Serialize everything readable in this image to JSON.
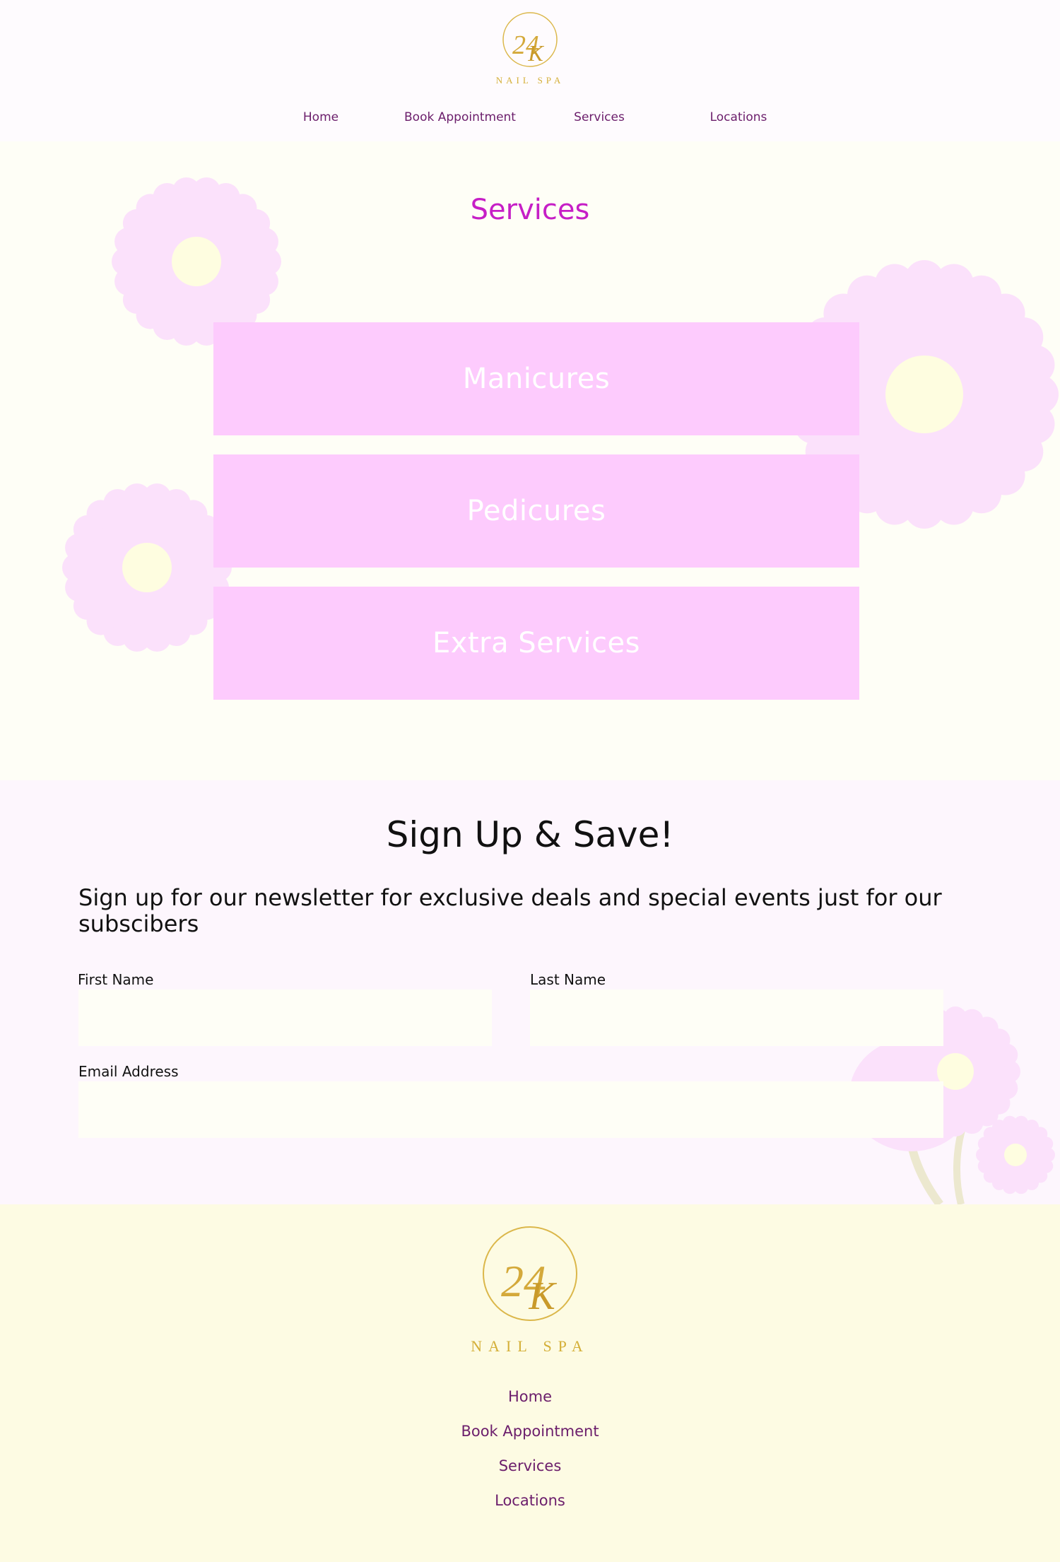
{
  "brand": {
    "monogram_top": "24",
    "monogram_bottom": "K",
    "name": "NAIL SPA"
  },
  "nav": {
    "items": [
      {
        "label": "Home"
      },
      {
        "label": "Book Appointment"
      },
      {
        "label": "Services"
      },
      {
        "label": "Locations"
      }
    ]
  },
  "services": {
    "title": "Services",
    "items": [
      {
        "label": "Manicures"
      },
      {
        "label": "Pedicures"
      },
      {
        "label": "Extra Services"
      }
    ]
  },
  "signup": {
    "title": "Sign Up & Save!",
    "description": "Sign up for our newsletter for exclusive deals and special events just for our subscibers",
    "fields": {
      "first_name": {
        "label": "First Name",
        "value": ""
      },
      "last_name": {
        "label": "Last Name",
        "value": ""
      },
      "email": {
        "label": "Email Address",
        "value": ""
      }
    }
  },
  "footer": {
    "links": [
      {
        "label": "Home"
      },
      {
        "label": "Book Appointment"
      },
      {
        "label": "Services"
      },
      {
        "label": "Locations"
      }
    ]
  },
  "colors": {
    "accent_magenta": "#c61ec6",
    "nav_purple": "#6b1d6b",
    "service_pink": "#fdcbfd",
    "flower_pink": "#fbe1fb",
    "flower_center": "#fefde0",
    "gold": "#d4af37"
  }
}
